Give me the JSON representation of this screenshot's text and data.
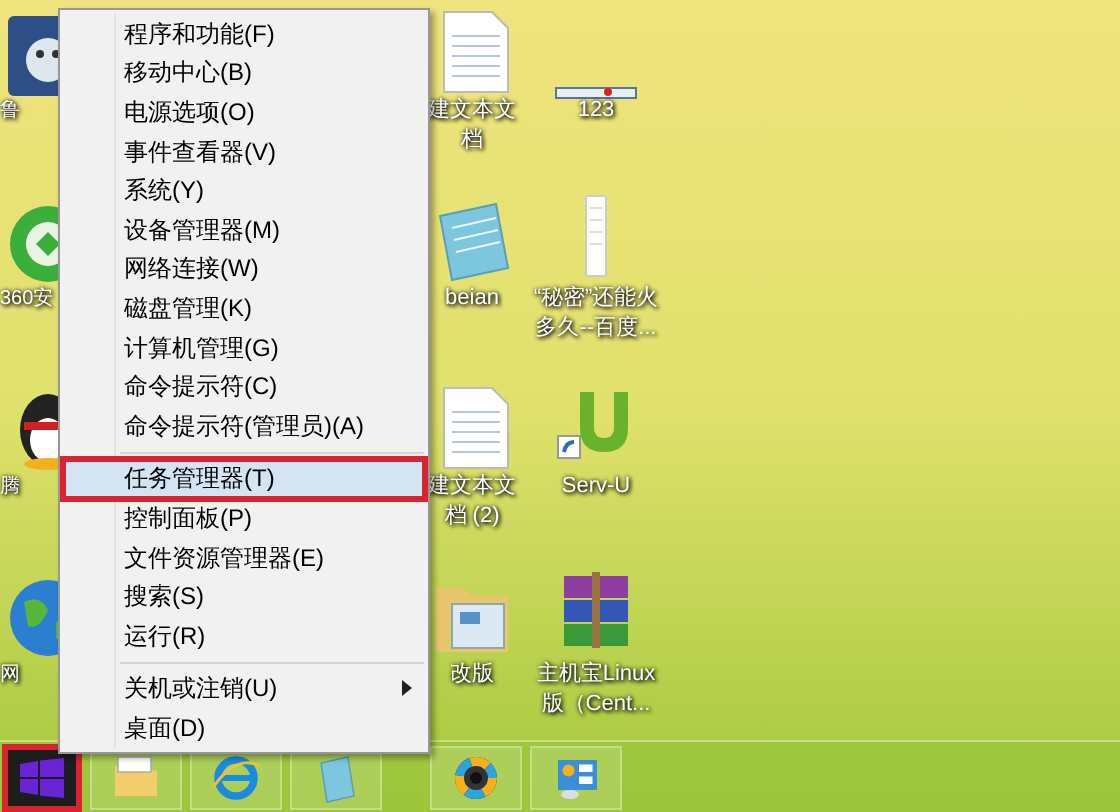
{
  "desktop_icons": [
    {
      "kind": "game",
      "lines": [
        "鲁"
      ]
    },
    {
      "kind": "guard",
      "lines": [
        "360安"
      ]
    },
    {
      "kind": "penguin",
      "lines": [
        "腾"
      ]
    },
    {
      "kind": "globe",
      "lines": [
        "网"
      ]
    },
    {
      "kind": "textdoc",
      "lines": [
        "建文本文",
        "档"
      ]
    },
    {
      "kind": "notepad",
      "lines": [
        "beian"
      ]
    },
    {
      "kind": "textdoc",
      "lines": [
        "建文本文",
        "档 (2)"
      ]
    },
    {
      "kind": "folder",
      "lines": [
        "改版"
      ]
    },
    {
      "kind": "strip",
      "lines": [
        "123"
      ]
    },
    {
      "kind": "paper",
      "lines": [
        "“秘密”还能火",
        "多久--百度..."
      ]
    },
    {
      "kind": "servu",
      "lines": [
        "Serv-U"
      ]
    },
    {
      "kind": "rar",
      "lines": [
        "主机宝Linux",
        "版（Cent..."
      ]
    }
  ],
  "context_menu": {
    "groups": [
      [
        {
          "label": "程序和功能(F)",
          "selected": false,
          "boxed": false,
          "submenu": false
        },
        {
          "label": "移动中心(B)",
          "selected": false,
          "boxed": false,
          "submenu": false
        },
        {
          "label": "电源选项(O)",
          "selected": false,
          "boxed": false,
          "submenu": false
        },
        {
          "label": "事件查看器(V)",
          "selected": false,
          "boxed": false,
          "submenu": false
        },
        {
          "label": "系统(Y)",
          "selected": false,
          "boxed": false,
          "submenu": false
        },
        {
          "label": "设备管理器(M)",
          "selected": false,
          "boxed": false,
          "submenu": false
        },
        {
          "label": "网络连接(W)",
          "selected": false,
          "boxed": false,
          "submenu": false
        },
        {
          "label": "磁盘管理(K)",
          "selected": false,
          "boxed": false,
          "submenu": false
        },
        {
          "label": "计算机管理(G)",
          "selected": false,
          "boxed": false,
          "submenu": false
        },
        {
          "label": "命令提示符(C)",
          "selected": false,
          "boxed": false,
          "submenu": false
        },
        {
          "label": "命令提示符(管理员)(A)",
          "selected": false,
          "boxed": false,
          "submenu": false
        }
      ],
      [
        {
          "label": "任务管理器(T)",
          "selected": true,
          "boxed": true,
          "submenu": false
        },
        {
          "label": "控制面板(P)",
          "selected": false,
          "boxed": false,
          "submenu": false
        },
        {
          "label": "文件资源管理器(E)",
          "selected": false,
          "boxed": false,
          "submenu": false
        },
        {
          "label": "搜索(S)",
          "selected": false,
          "boxed": false,
          "submenu": false
        },
        {
          "label": "运行(R)",
          "selected": false,
          "boxed": false,
          "submenu": false
        }
      ],
      [
        {
          "label": "关机或注销(U)",
          "selected": false,
          "boxed": false,
          "submenu": true
        },
        {
          "label": "桌面(D)",
          "selected": false,
          "boxed": false,
          "submenu": false
        }
      ]
    ]
  },
  "taskbar": {
    "start_boxed": true
  }
}
